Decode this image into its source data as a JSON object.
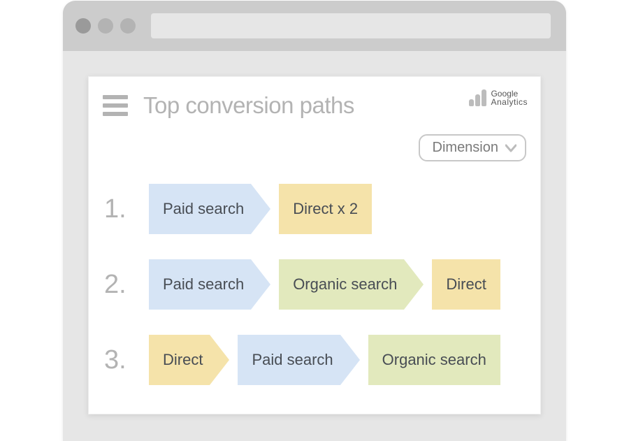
{
  "page_title": "Top conversion paths",
  "brand": {
    "name_top": "Google",
    "name_bottom": "Analytics"
  },
  "dropdown_label": "Dimension",
  "colors": {
    "paid_search": "#d6e4f5",
    "direct": "#f5e3aa",
    "organic_search": "#e2e9bd"
  },
  "paths": [
    {
      "num": "1.",
      "steps": [
        {
          "label": "Paid search",
          "style": "c-blue",
          "arrow": true
        },
        {
          "label": "Direct x 2",
          "style": "c-yellow",
          "arrow": false
        }
      ]
    },
    {
      "num": "2.",
      "steps": [
        {
          "label": "Paid search",
          "style": "c-blue",
          "arrow": true
        },
        {
          "label": "Organic search",
          "style": "c-green",
          "arrow": true
        },
        {
          "label": "Direct",
          "style": "c-yellow",
          "arrow": false
        }
      ]
    },
    {
      "num": "3.",
      "steps": [
        {
          "label": "Direct",
          "style": "c-yellow",
          "arrow": true
        },
        {
          "label": "Paid search",
          "style": "c-blue",
          "arrow": true
        },
        {
          "label": "Organic search",
          "style": "c-green",
          "arrow": false
        }
      ]
    }
  ]
}
